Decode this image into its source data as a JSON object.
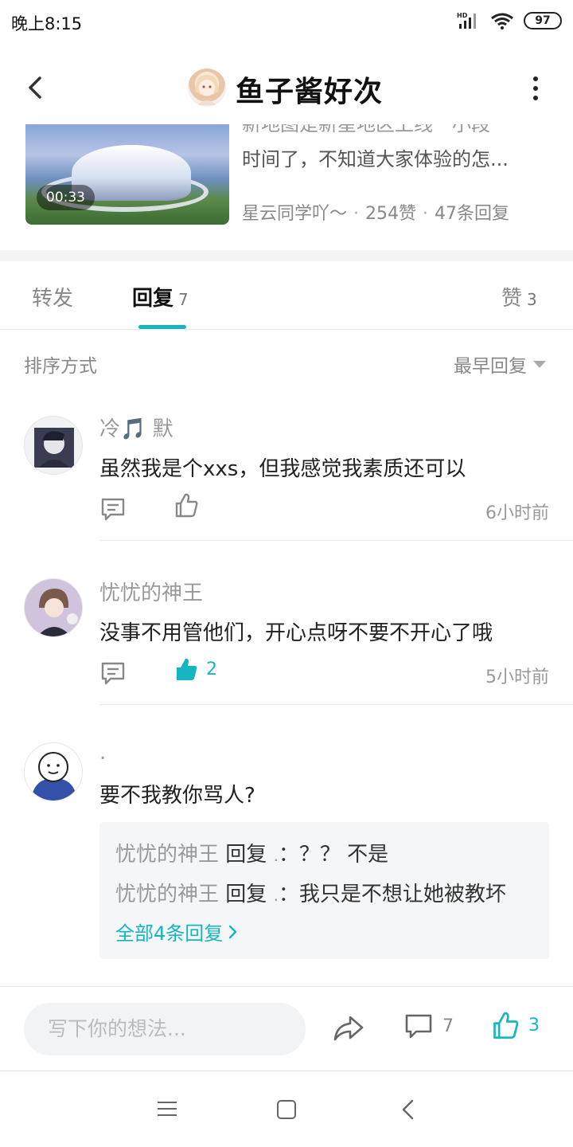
{
  "status_bar": {
    "time": "晚上8:15",
    "network": "HD",
    "battery": "97",
    "icons": [
      "signal-icon",
      "wifi-icon",
      "battery-icon"
    ]
  },
  "header": {
    "title": "鱼子酱好次",
    "back_icon": "chevron-left-icon",
    "more_icon": "more-vertical-icon"
  },
  "post": {
    "duration": "00:33",
    "text_line1": "新地图是新星地区上线一小段",
    "text_line2": "时间了，不知道大家体验的怎...",
    "author": "星云同学吖～",
    "likes": "254赞",
    "replies": "47条回复"
  },
  "tabs": [
    {
      "label": "转发",
      "count": ""
    },
    {
      "label": "回复",
      "count": "7"
    },
    {
      "label": "赞",
      "count": "3"
    }
  ],
  "sort": {
    "label": "排序方式",
    "value": "最早回复"
  },
  "comments": [
    {
      "user": "冷🎵 默",
      "text": "虽然我是个xxs，但我感觉我素质还可以",
      "likes": "",
      "time": "6小时前",
      "liked": false
    },
    {
      "user": "忧忧的神王",
      "text": "没事不用管他们，开心点呀不要不开心了哦",
      "likes": "2",
      "time": "5小时前",
      "liked": true
    },
    {
      "user": ".",
      "text": "要不我教你骂人?",
      "replies": [
        {
          "who": "忧忧的神王",
          "verb": "回复",
          "target": ".",
          "msg": "：？？ 不是"
        },
        {
          "who": "忧忧的神王",
          "verb": "回复",
          "target": ".",
          "msg": "：我只是不想让她被教坏"
        }
      ],
      "more_replies": "全部4条回复"
    }
  ],
  "bottom_bar": {
    "placeholder": "写下你的想法...",
    "comment_count": "7",
    "like_count": "3"
  },
  "colors": {
    "accent": "#17b5c1",
    "muted": "#999999",
    "text": "#222222"
  }
}
